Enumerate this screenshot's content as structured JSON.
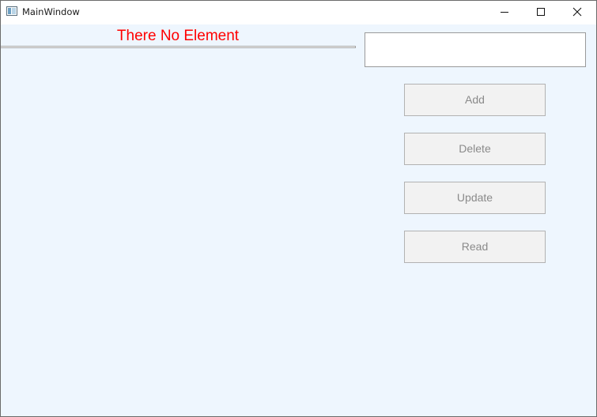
{
  "window": {
    "title": "MainWindow",
    "app_icon": "window-app-icon",
    "controls": {
      "minimize_icon": "minimize-icon",
      "maximize_icon": "maximize-icon",
      "close_icon": "close-icon"
    }
  },
  "main": {
    "status_text": "There No Element",
    "status_color": "#ff0000",
    "background_color": "#eef6fe",
    "input": {
      "value": "",
      "placeholder": ""
    },
    "buttons": {
      "add": "Add",
      "delete": "Delete",
      "update": "Update",
      "read": "Read"
    }
  }
}
